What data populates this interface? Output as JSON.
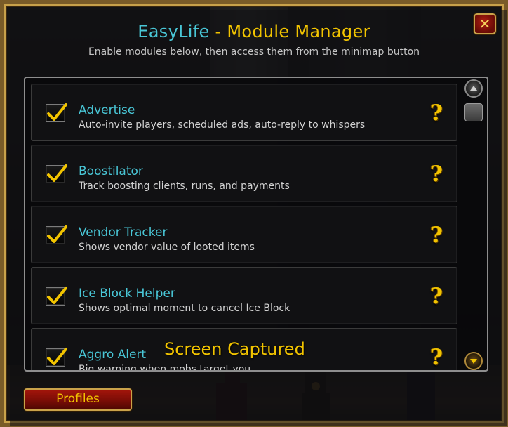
{
  "window": {
    "title_addon": "EasyLife",
    "title_separator": "-",
    "title_rest": "Module Manager",
    "subtitle": "Enable modules below, then access them from the minimap button",
    "close_label": "✕"
  },
  "modules": [
    {
      "name": "Advertise",
      "description": "Auto-invite players, scheduled ads, auto-reply to whispers",
      "enabled": true,
      "help": "?"
    },
    {
      "name": "Boostilator",
      "description": "Track boosting clients, runs, and payments",
      "enabled": true,
      "help": "?"
    },
    {
      "name": "Vendor Tracker",
      "description": "Shows vendor value of looted items",
      "enabled": true,
      "help": "?"
    },
    {
      "name": "Ice Block Helper",
      "description": "Shows optimal moment to cancel Ice Block",
      "enabled": true,
      "help": "?"
    },
    {
      "name": "Aggro Alert",
      "description": "Big warning when mobs target you",
      "enabled": true,
      "help": "?"
    }
  ],
  "overlay": {
    "text": "Screen Captured"
  },
  "footer": {
    "profiles_label": "Profiles"
  },
  "colors": {
    "accent_cyan": "#49c6d6",
    "accent_gold": "#f2c400",
    "button_red": "#a3150b"
  }
}
